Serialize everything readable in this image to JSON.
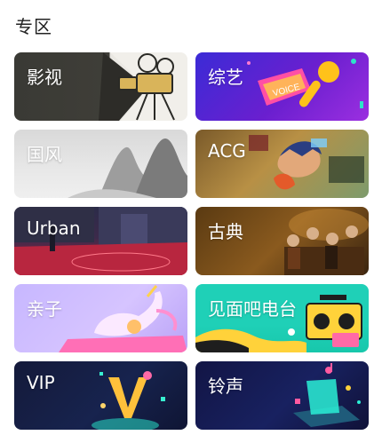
{
  "section": {
    "title": "专区"
  },
  "tiles": [
    {
      "label": "影视"
    },
    {
      "label": "综艺"
    },
    {
      "label": "国风"
    },
    {
      "label": "ACG"
    },
    {
      "label": "Urban"
    },
    {
      "label": "古典"
    },
    {
      "label": "亲子"
    },
    {
      "label": "见面吧电台"
    },
    {
      "label": "VIP"
    },
    {
      "label": "铃声"
    }
  ],
  "decor": {
    "variety_sign": "VOICE"
  }
}
